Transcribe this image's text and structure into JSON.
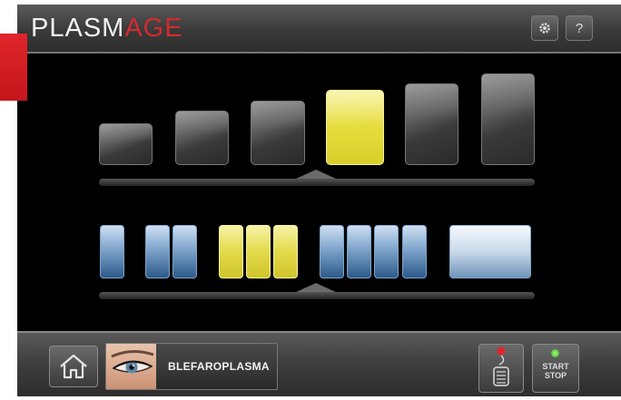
{
  "header": {
    "brand_part1": "PLASM",
    "brand_part2": "AGE",
    "settings_icon": "gear-icon",
    "help_label": "?"
  },
  "tips": {
    "count": 6,
    "selected_index": 3
  },
  "cells": {
    "groups": [
      1,
      2,
      3,
      4,
      1
    ],
    "selected_group": 2
  },
  "footer": {
    "program_label": "BLEFAROPLASMA",
    "start_label": "START",
    "stop_label": "STOP",
    "home_icon": "home-icon",
    "pedal_icon": "foot-pedal-icon"
  },
  "colors": {
    "brand_red": "#d42a2e",
    "selected_yellow": "#e6dc3c",
    "cell_blue": "#2d5a8a",
    "status_green": "#3aa32a"
  }
}
